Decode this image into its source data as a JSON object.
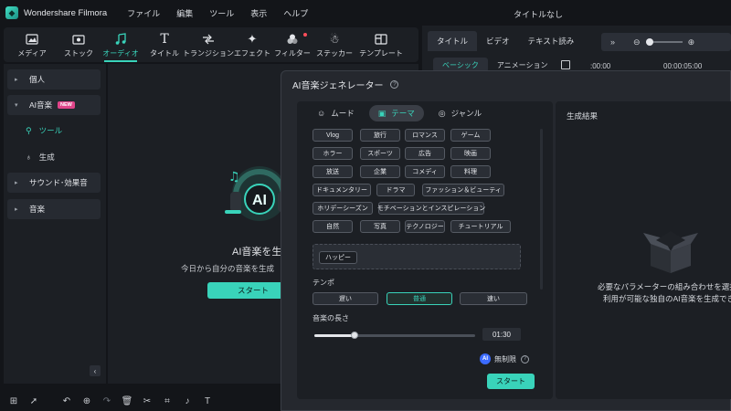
{
  "app": {
    "name": "Wondershare Filmora",
    "document_title": "タイトルなし",
    "menu": [
      "ファイル",
      "編集",
      "ツール",
      "表示",
      "ヘルプ"
    ]
  },
  "toolbar": {
    "items": [
      {
        "label": "メディア",
        "icon": "media-icon"
      },
      {
        "label": "ストック",
        "icon": "stock-icon"
      },
      {
        "label": "オーディオ",
        "icon": "audio-note-icon",
        "active": true
      },
      {
        "label": "タイトル",
        "icon": "title-icon"
      },
      {
        "label": "トランジション",
        "icon": "transition-icon"
      },
      {
        "label": "エフェクト",
        "icon": "effect-icon"
      },
      {
        "label": "フィルター",
        "icon": "filter-icon",
        "dot": true
      },
      {
        "label": "ステッカー",
        "icon": "sticker-icon"
      },
      {
        "label": "テンプレート",
        "icon": "template-icon"
      }
    ]
  },
  "sidebar": {
    "items": [
      {
        "label": "個人"
      },
      {
        "label": "AI音楽",
        "badge": "NEW"
      },
      {
        "label": "サウンド･効果音"
      },
      {
        "label": "音楽"
      }
    ],
    "subitems": [
      {
        "label": "ツール",
        "active": true
      },
      {
        "label": "生成"
      }
    ]
  },
  "center": {
    "title": "AI音楽を生",
    "subtitle": "今日から自分の音楽を生成",
    "start": "スタート",
    "hero_text": "AI"
  },
  "right_panel": {
    "tabs": [
      "タイトル",
      "ビデオ",
      "テキスト読み"
    ],
    "subtabs": [
      "ベーシック",
      "アニメーション"
    ],
    "time_start": ":00:00",
    "time_end": "00:00:05:00"
  },
  "dialog": {
    "title": "AI音楽ジェネレーター",
    "mode_tabs": [
      {
        "label": "ムード",
        "icon": "mood-icon"
      },
      {
        "label": "テーマ",
        "icon": "theme-icon",
        "active": true
      },
      {
        "label": "ジャンル",
        "icon": "genre-icon"
      }
    ],
    "themes": [
      [
        "Vlog",
        "旅行",
        "ロマンス",
        "ゲーム"
      ],
      [
        "ホラー",
        "スポーツ",
        "広告",
        "映画"
      ],
      [
        "放送",
        "企業",
        "コメディ",
        "料理"
      ],
      [
        "ドキュメンタリー",
        "ドラマ",
        "ファッション＆ビューティ"
      ],
      [
        "ホリデーシーズン",
        "モチベーションとインスピレーション"
      ],
      [
        "自然",
        "写真",
        "テクノロジー",
        "チュートリアル"
      ]
    ],
    "selected_chip": "ハッピー",
    "tempo_label": "テンポ",
    "tempo_options": [
      "遅い",
      "普通",
      "速い"
    ],
    "tempo_selected": 1,
    "length_label": "音楽の長さ",
    "length_value": "01:30",
    "length_fraction": 0.25,
    "credit_label": "無制限",
    "credit_badge": "AI",
    "start": "スタート",
    "result_title": "生成結果",
    "result_msg1": "必要なパラメーターの組み合わせを選択して、",
    "result_msg2": "利用が可能な独自のAI音楽を生成できま"
  },
  "colors": {
    "accent": "#39d3ba",
    "background": "#131519",
    "panel": "#1c1f24",
    "dialog": "#25282e",
    "new_badge": "#e0458a"
  }
}
